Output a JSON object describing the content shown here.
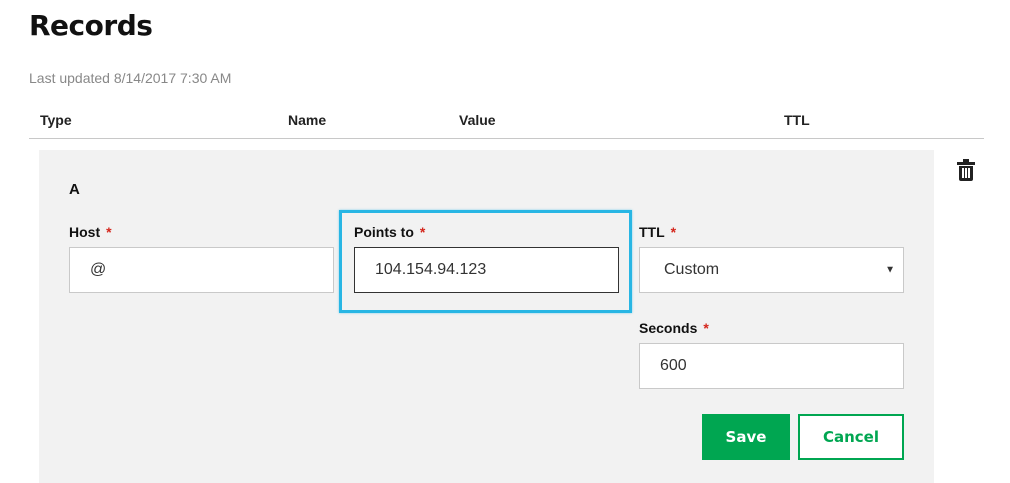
{
  "page": {
    "title": "Records",
    "last_updated": "Last updated 8/14/2017 7:30 AM"
  },
  "table": {
    "columns": [
      "Type",
      "Name",
      "Value",
      "TTL"
    ]
  },
  "record": {
    "type": "A",
    "host": {
      "label": "Host",
      "required_mark": "*",
      "value": "@"
    },
    "points_to": {
      "label": "Points to",
      "required_mark": "*",
      "value": "104.154.94.123",
      "highlighted": true,
      "highlight_color": "#28b6e4"
    },
    "ttl": {
      "label": "TTL",
      "required_mark": "*",
      "selected": "Custom"
    },
    "seconds": {
      "label": "Seconds",
      "required_mark": "*",
      "value": "600"
    }
  },
  "actions": {
    "save_label": "Save",
    "cancel_label": "Cancel",
    "delete_icon": "trash-icon"
  },
  "colors": {
    "accent": "#00a651",
    "required": "#d4261c",
    "panel_bg": "#f2f2f2"
  }
}
